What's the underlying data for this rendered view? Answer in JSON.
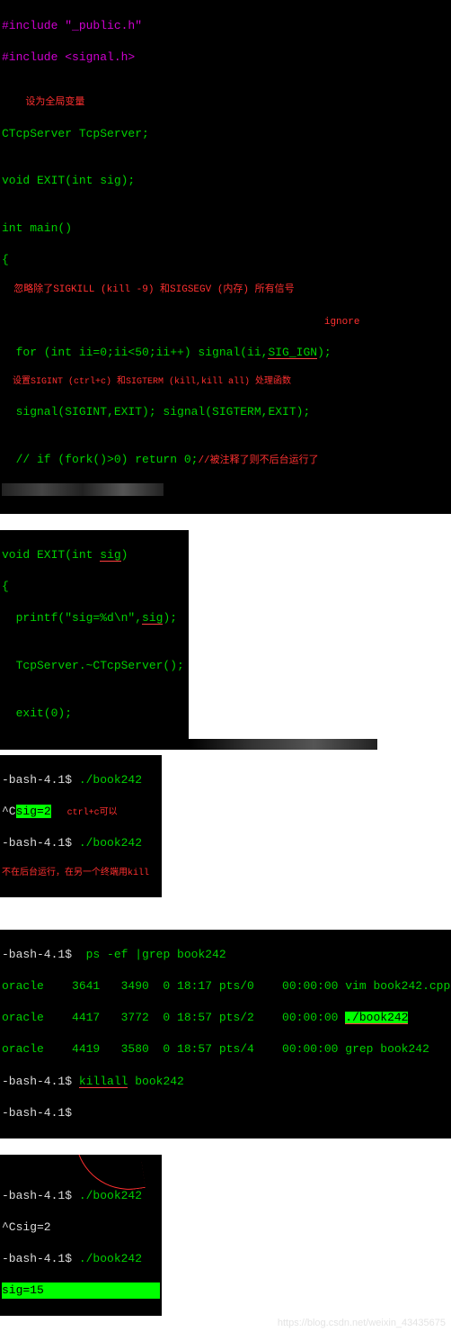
{
  "pane1": {
    "inc1": "#include \"_public.h\"",
    "inc2": "#include <signal.h>",
    "anno1": "    设为全局变量",
    "decl1": "CTcpServer TcpServer;",
    "decl2": "void EXIT(int sig);",
    "mainopen": "int main()",
    "brace": "{",
    "anno2": "  忽略除了SIGKILL (kill -9) 和SIGSEGV (内存) 所有信号",
    "ignore": "ignore",
    "for1a": "  for (int ii=0;ii<50;ii++) signal(ii,",
    "for1b": "SIG_IGN",
    "for1c": ");",
    "anno3": "  设置SIGINT (ctrl+c) 和SIGTERM (kill,kill all) 处理函数",
    "sigline": "  signal(SIGINT,EXIT); signal(SIGTERM,EXIT);",
    "forkline": "  // if (fork()>0) return 0;",
    "anno4": "//被注释了则不后台运行了"
  },
  "pane2": {
    "fn1a": "void EXIT(int ",
    "fn1b": "sig",
    "fn1c": ")",
    "brace": "{",
    "pr1a": "  printf(\"sig=%d\\n\",",
    "pr1b": "sig",
    "pr1c": ");",
    "dtor": "  TcpServer.~CTcpServer();",
    "exitl": "  exit(0);"
  },
  "pane3": {
    "p1": "-bash-4.1$ ",
    "cmd1": "./book242",
    "pre_sig": "^C",
    "sig2": "sig=2",
    "anno": "   ctrl+c可以",
    "p2": "-bash-4.1$ ",
    "cmd2": "./book242",
    "anno2": "不在后台运行，在另一个终端用kill"
  },
  "pane4": {
    "p1": "-bash-4.1$  ",
    "cmd1": "ps -ef |grep book242",
    "row1a": "oracle    3641   3490  0 18:17 pts/0    00:00:00 ",
    "row1b": "vim book242.cpp",
    "row2a": "oracle    4417   3772  0 18:57 pts/2    00:00:00 ",
    "row2b": "./book242",
    "row3a": "oracle    4419   3580  0 18:57 pts/4    00:00:00 ",
    "row3b": "grep book242",
    "p2": "-bash-4.1$ ",
    "cmd2a": "killall",
    "cmd2b": " book242",
    "p3": "-bash-4.1$"
  },
  "pane5": {
    "p1": "-bash-4.1$ ",
    "cmd1": "./book242",
    "sig2": "^Csig=2",
    "p2": "-bash-4.1$ ",
    "cmd2": "./book242",
    "sig15": "sig=15"
  },
  "watermark": "https://blog.csdn.net/weixin_43435675"
}
